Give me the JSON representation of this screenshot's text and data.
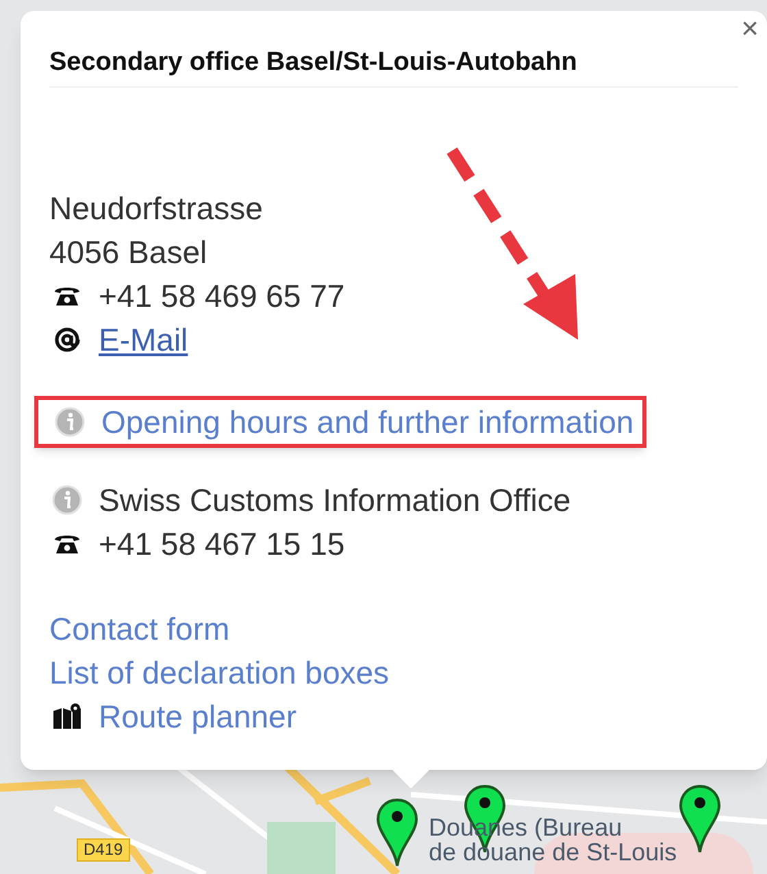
{
  "popup": {
    "title": "Secondary office Basel/St-Louis-Autobahn",
    "close": "×",
    "address": [
      "Neudorfstrasse",
      "4056 Basel"
    ],
    "contacts": [
      {
        "kind": "phone",
        "text": "+41 58 469 65 77"
      },
      {
        "kind": "email",
        "text": "E-Mail"
      }
    ],
    "info_link": {
      "label": "Opening hours and further information",
      "highlighted": true
    },
    "office": {
      "name": "Swiss Customs Information Office",
      "phone": "+41 58 467 15 15"
    },
    "links": [
      {
        "kind": "plain",
        "label": "Contact form"
      },
      {
        "kind": "plain",
        "label": "List of declaration boxes"
      },
      {
        "kind": "route",
        "label": "Route planner"
      }
    ]
  },
  "map": {
    "road_label": "D419",
    "place_label": [
      "Douanes (Bureau",
      "de douane de St-Louis"
    ]
  }
}
